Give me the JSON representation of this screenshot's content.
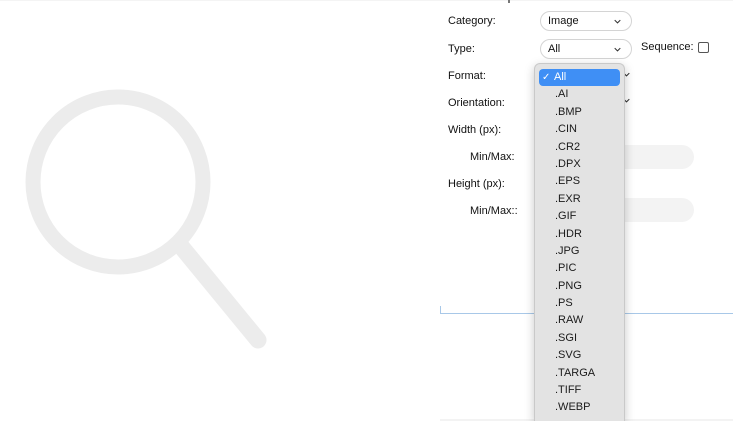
{
  "form": {
    "category": {
      "label": "Category:",
      "value": "Image"
    },
    "type": {
      "label": "Type:",
      "value": "All"
    },
    "sequence": {
      "label": "Sequence:",
      "checked": false
    },
    "format": {
      "label": "Format:"
    },
    "orientation": {
      "label": "Orientation:"
    },
    "width": {
      "label": "Width (px):",
      "minmax_label": "Min/Max:"
    },
    "height": {
      "label": "Height (px):",
      "minmax_label": "Min/Max::"
    }
  },
  "format_dropdown": {
    "selected": "All",
    "options": [
      ".AI",
      ".BMP",
      ".CIN",
      ".CR2",
      ".DPX",
      ".EPS",
      ".EXR",
      ".GIF",
      ".HDR",
      ".JPG",
      ".PIC",
      ".PNG",
      ".PS",
      ".RAW",
      ".SGI",
      ".SVG",
      ".TARGA",
      ".TIFF",
      ".WEBP"
    ]
  },
  "icons": {
    "background": "search-icon",
    "select_indicator": "chevron-down-icon",
    "selected_indicator": "check-icon"
  },
  "colors": {
    "selection": "#3f8ff5",
    "menu_background": "#e3e3e3",
    "background_icon": "#ececec",
    "accent_line": "#a8c8e8"
  }
}
